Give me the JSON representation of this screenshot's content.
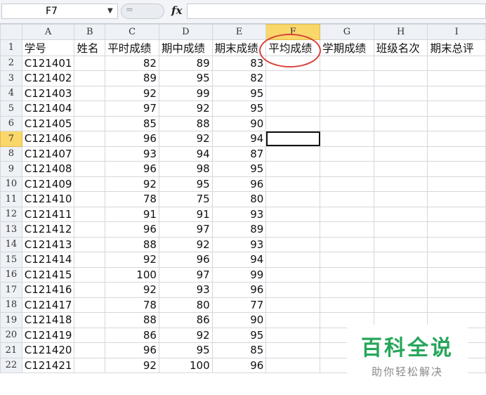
{
  "formula_bar": {
    "name_box": "F7",
    "name_box_caret": "▼",
    "cancel_glyph": "=",
    "fx_label": "fx",
    "formula": ""
  },
  "sheet": {
    "active_cell": "F7",
    "selected_column": "F",
    "columns": [
      "A",
      "B",
      "C",
      "D",
      "E",
      "F",
      "G",
      "H",
      "I"
    ],
    "header_row": [
      "学号",
      "姓名",
      "平时成绩",
      "期中成绩",
      "期末成绩",
      "平均成绩",
      "学期成绩",
      "班级名次",
      "期末总评"
    ],
    "rows": [
      {
        "n": "2",
        "id": "C121401",
        "c": "82",
        "d": "89",
        "e": "83"
      },
      {
        "n": "3",
        "id": "C121402",
        "c": "89",
        "d": "95",
        "e": "82"
      },
      {
        "n": "4",
        "id": "C121403",
        "c": "92",
        "d": "99",
        "e": "95"
      },
      {
        "n": "5",
        "id": "C121404",
        "c": "97",
        "d": "92",
        "e": "95"
      },
      {
        "n": "6",
        "id": "C121405",
        "c": "85",
        "d": "88",
        "e": "90"
      },
      {
        "n": "7",
        "id": "C121406",
        "c": "96",
        "d": "92",
        "e": "94"
      },
      {
        "n": "8",
        "id": "C121407",
        "c": "93",
        "d": "94",
        "e": "87"
      },
      {
        "n": "9",
        "id": "C121408",
        "c": "96",
        "d": "98",
        "e": "95"
      },
      {
        "n": "10",
        "id": "C121409",
        "c": "92",
        "d": "95",
        "e": "96"
      },
      {
        "n": "11",
        "id": "C121410",
        "c": "78",
        "d": "75",
        "e": "80"
      },
      {
        "n": "12",
        "id": "C121411",
        "c": "91",
        "d": "91",
        "e": "93"
      },
      {
        "n": "13",
        "id": "C121412",
        "c": "96",
        "d": "97",
        "e": "89"
      },
      {
        "n": "14",
        "id": "C121413",
        "c": "88",
        "d": "92",
        "e": "93"
      },
      {
        "n": "15",
        "id": "C121414",
        "c": "92",
        "d": "96",
        "e": "94"
      },
      {
        "n": "16",
        "id": "C121415",
        "c": "100",
        "d": "97",
        "e": "99"
      },
      {
        "n": "17",
        "id": "C121416",
        "c": "92",
        "d": "93",
        "e": "96"
      },
      {
        "n": "18",
        "id": "C121417",
        "c": "78",
        "d": "80",
        "e": "77"
      },
      {
        "n": "19",
        "id": "C121418",
        "c": "88",
        "d": "86",
        "e": "90"
      },
      {
        "n": "20",
        "id": "C121419",
        "c": "86",
        "d": "92",
        "e": "95"
      },
      {
        "n": "21",
        "id": "C121420",
        "c": "96",
        "d": "95",
        "e": "85"
      },
      {
        "n": "22",
        "id": "C121421",
        "c": "92",
        "d": "100",
        "e": "96"
      }
    ]
  },
  "watermark": {
    "title": "百科全说",
    "subtitle": "助你轻松解决",
    "color": "#26a65b"
  },
  "annotation": {
    "color": "#d8423a",
    "target": "平均成绩"
  }
}
